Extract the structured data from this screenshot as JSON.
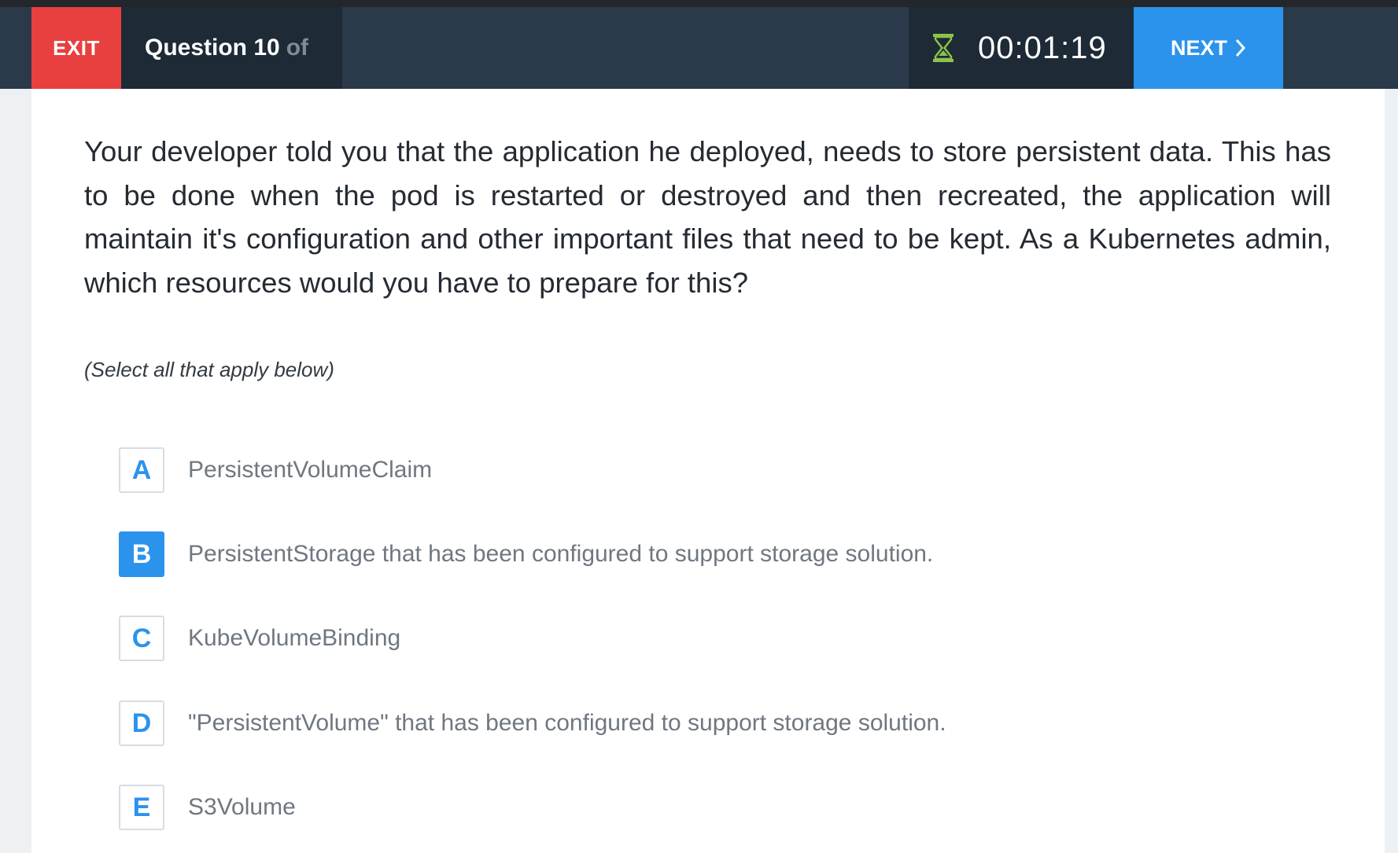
{
  "header": {
    "exit_label": "EXIT",
    "question_label": "Question 10",
    "question_of": "of",
    "timer": "00:01:19",
    "timer_icon": "hourglass-icon",
    "next_label": "NEXT",
    "next_icon": "chevron-right-icon"
  },
  "question": {
    "text": "Your developer told you that the application he deployed, needs to store persistent data. This has to be done when the pod is restarted or destroyed and then recreated, the application will maintain it's configuration and other important files that need to be kept. As a Kubernetes admin, which resources would you have to prepare for this?",
    "hint": "(Select all that apply below)"
  },
  "options": [
    {
      "letter": "A",
      "label": "PersistentVolumeClaim",
      "selected": false
    },
    {
      "letter": "B",
      "label": "PersistentStorage that has been configured to support storage solution.",
      "selected": true
    },
    {
      "letter": "C",
      "label": "KubeVolumeBinding",
      "selected": false
    },
    {
      "letter": "D",
      "label": "\"PersistentVolume\" that has been configured to support storage solution.",
      "selected": false
    },
    {
      "letter": "E",
      "label": "S3Volume",
      "selected": false
    }
  ],
  "colors": {
    "exit": "#e8403f",
    "next": "#2b93ec",
    "topbar": "#2b3a4a",
    "accent": "#2b93ec",
    "hourglass": "#8bc34a"
  }
}
